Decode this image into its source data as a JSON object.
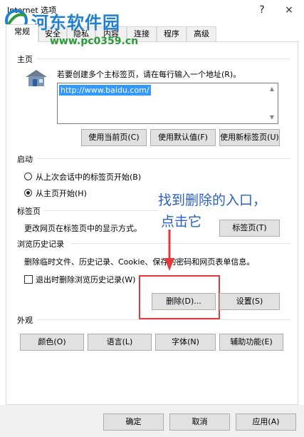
{
  "window": {
    "title": "Internet 选项",
    "help": "?",
    "close": "×"
  },
  "watermark": {
    "site_name": "河东软件园",
    "url": "www.pc0359.cn"
  },
  "tabs": [
    {
      "label": "常规"
    },
    {
      "label": "安全"
    },
    {
      "label": "隐私"
    },
    {
      "label": "内容"
    },
    {
      "label": "连接"
    },
    {
      "label": "程序"
    },
    {
      "label": "高级"
    }
  ],
  "home": {
    "heading": "主页",
    "instruction": "若要创建多个主标签页，请在每行输入一个地址(R)。",
    "url": "http://www.baidu.com/",
    "buttons": [
      "使用当前页(C)",
      "使用默认值(F)",
      "使用新标签页(U)"
    ]
  },
  "startup": {
    "heading": "启动",
    "options": [
      {
        "label": "从上次会话中的标签页开始(B)",
        "selected": false
      },
      {
        "label": "从主页开始(H)",
        "selected": true
      }
    ]
  },
  "tabs_section": {
    "heading": "标签页",
    "description": "更改网页在标签页中的显示方式。",
    "button": "标签页(T)"
  },
  "history": {
    "heading": "浏览历史记录",
    "description": "删除临时文件、历史记录、Cookie、保存的密码和网页表单信息。",
    "checkbox_label": "退出时删除浏览历史记录(W)",
    "checkbox_checked": false,
    "delete_button": "删除(D)...",
    "settings_button": "设置(S)"
  },
  "appearance": {
    "heading": "外观",
    "buttons": [
      "颜色(O)",
      "语言(L)",
      "字体(N)",
      "辅助功能(E)"
    ]
  },
  "annotation": {
    "line1": "找到删除的入口，",
    "line2": "点击它"
  },
  "footer": {
    "ok": "确定",
    "cancel": "取消",
    "apply": "应用(A)"
  },
  "colors": {
    "highlight": "#e23a3a",
    "annotation_text": "#2a5fc7",
    "selection": "#3399ff"
  }
}
